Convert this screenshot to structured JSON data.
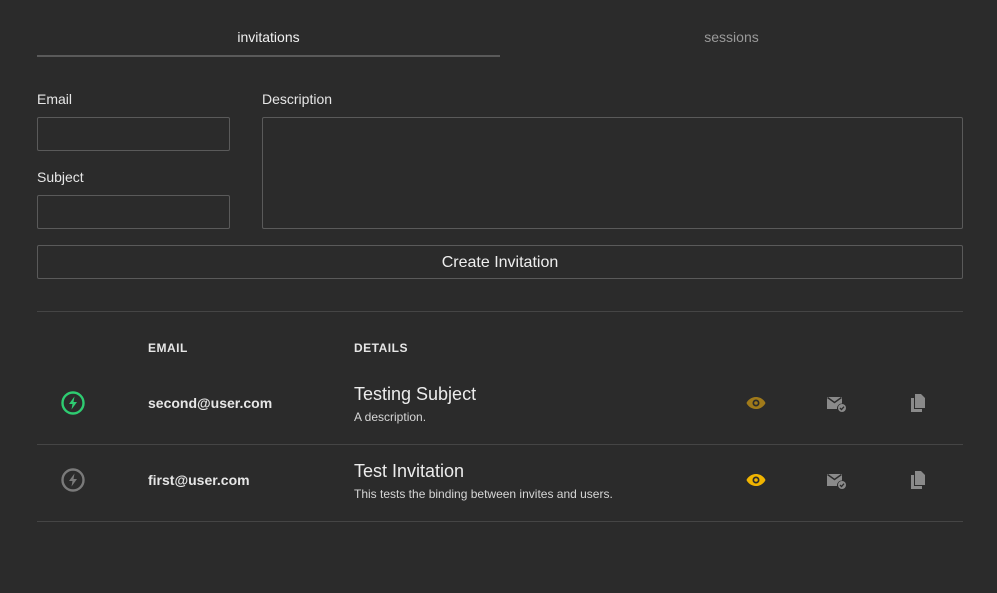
{
  "tabs": [
    {
      "label": "invitations",
      "active": true
    },
    {
      "label": "sessions",
      "active": false
    }
  ],
  "form": {
    "email_label": "Email",
    "email_value": "",
    "subject_label": "Subject",
    "subject_value": "",
    "description_label": "Description",
    "description_value": "",
    "create_button_label": "Create Invitation"
  },
  "table": {
    "columns": [
      "EMAIL",
      "DETAILS"
    ],
    "rows": [
      {
        "status_icon": "bolt-circle-icon",
        "status_color": "#2ecc71",
        "email": "second@user.com",
        "subject": "Testing Subject",
        "description": "A description.",
        "eye_color": "#a07a1a"
      },
      {
        "status_icon": "bolt-circle-icon",
        "status_color": "#7a7a7a",
        "email": "first@user.com",
        "subject": "Test Invitation",
        "description": "This tests the binding between invites and users.",
        "eye_color": "#f0b400"
      }
    ]
  },
  "colors": {
    "background": "#2b2b2b",
    "border": "#5a5a5a",
    "icon_gray": "#8a8a8a"
  }
}
